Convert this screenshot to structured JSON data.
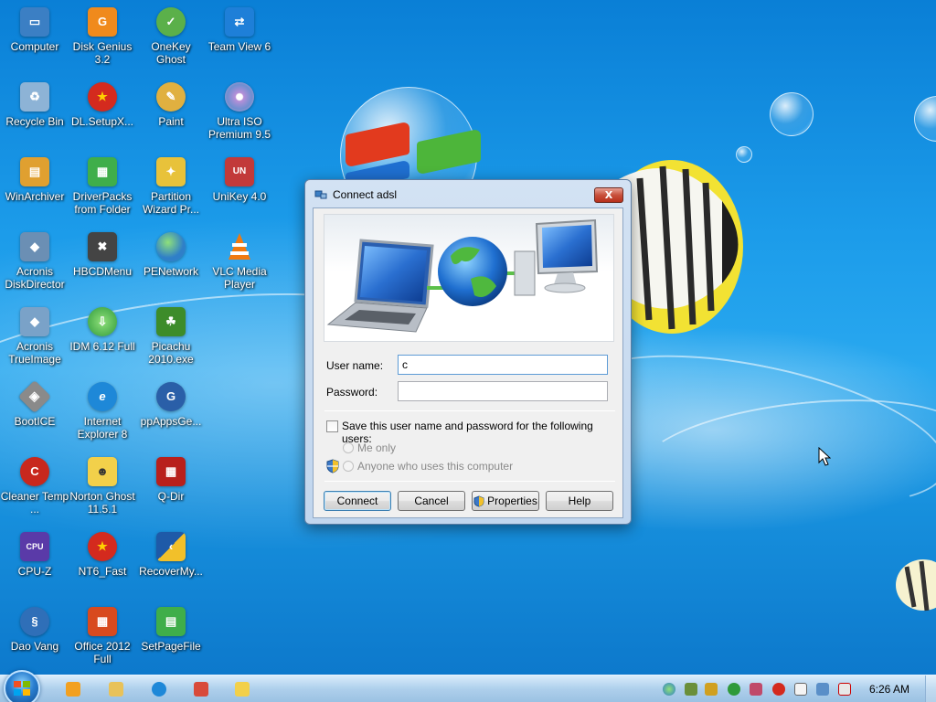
{
  "desktop": {
    "icons": [
      {
        "label": "Computer",
        "icon": "computer-icon",
        "color": "#3b7fc4"
      },
      {
        "label": "Disk Genius 3.2",
        "icon": "diskgenius-icon",
        "color": "#f08a1c"
      },
      {
        "label": "OneKey Ghost",
        "icon": "onekey-ghost-icon",
        "color": "#5bb04a"
      },
      {
        "label": "Team View 6",
        "icon": "teamviewer-icon",
        "color": "#1e7fd8"
      },
      {
        "label": "Recycle Bin",
        "icon": "recycle-bin-icon",
        "color": "#8db3d6"
      },
      {
        "label": "DL.SetupX...",
        "icon": "star-icon",
        "color": "#d42a1e"
      },
      {
        "label": "Paint",
        "icon": "paint-icon",
        "color": "#e0b040"
      },
      {
        "label": "Ultra ISO Premium 9.5",
        "icon": "disc-icon",
        "color": "#9a6fc2"
      },
      {
        "label": "WinArchiver",
        "icon": "archive-icon",
        "color": "#e0a030"
      },
      {
        "label": "DriverPacks from Folder",
        "icon": "driverpacks-icon",
        "color": "#3fae4a"
      },
      {
        "label": "Partition Wizard Pr...",
        "icon": "partition-wizard-icon",
        "color": "#e8c23a"
      },
      {
        "label": "UniKey 4.0",
        "icon": "unikey-icon",
        "color": "#c23a3a"
      },
      {
        "label": "Acronis DiskDirector",
        "icon": "acronis-icon",
        "color": "#6b8fb4"
      },
      {
        "label": "HBCDMenu",
        "icon": "tools-icon",
        "color": "#444444"
      },
      {
        "label": "PENetwork",
        "icon": "network-globe-icon",
        "color": "#2f7fc8"
      },
      {
        "label": "VLC Media Player",
        "icon": "vlc-icon",
        "color": "#f07a10"
      },
      {
        "label": "Acronis TrueImage",
        "icon": "acronis-icon",
        "color": "#7aa2c8"
      },
      {
        "label": "IDM 6.12 Full",
        "icon": "idm-icon",
        "color": "#2f9a3a"
      },
      {
        "label": "Picachu 2010.exe",
        "icon": "picachu-icon",
        "color": "#3d8c2a"
      },
      {
        "label": "BootICE",
        "icon": "bootice-icon",
        "color": "#8a8a8a"
      },
      {
        "label": "Internet Explorer 8",
        "icon": "ie-icon",
        "color": "#1e88d8"
      },
      {
        "label": "ppAppsGe...",
        "icon": "ppapps-icon",
        "color": "#2a5fa8"
      },
      {
        "label": "Cleaner Temp ...",
        "icon": "ccleaner-icon",
        "color": "#c8281e"
      },
      {
        "label": "Norton Ghost 11.5.1",
        "icon": "ghost-icon",
        "color": "#f2d04a"
      },
      {
        "label": "Q-Dir",
        "icon": "qdir-icon",
        "color": "#b8201c"
      },
      {
        "label": "CPU-Z",
        "icon": "cpuz-icon",
        "color": "#5a3aa8"
      },
      {
        "label": "NT6_Fast",
        "icon": "star-icon",
        "color": "#d42a1e"
      },
      {
        "label": "RecoverMy...",
        "icon": "recover-icon",
        "color": "#1e5aa8"
      },
      {
        "label": "Dao Vang",
        "icon": "daovang-icon",
        "color": "#2f6fb8"
      },
      {
        "label": "Office 2012 Full",
        "icon": "office-icon",
        "color": "#d84a1e"
      },
      {
        "label": "SetPageFile",
        "icon": "setpagefile-icon",
        "color": "#3fae4a"
      }
    ]
  },
  "dialog": {
    "title": "Connect adsl",
    "close_symbol": "X",
    "username_label": "User name:",
    "username_value": "c",
    "password_label": "Password:",
    "password_value": "",
    "save_label": "Save this user name and password for the following users:",
    "save_checked": false,
    "me_only_label": "Me only",
    "anyone_label": "Anyone who uses this computer",
    "buttons": {
      "connect": "Connect",
      "cancel": "Cancel",
      "properties": "Properties",
      "help": "Help"
    }
  },
  "taskbar": {
    "pinned": [
      "media-player-icon",
      "explorer-icon",
      "ie-icon",
      "paint-icon",
      "ghost-icon"
    ],
    "tray": [
      "network-globe-icon",
      "tray-tool-icon",
      "shield-icon",
      "play-icon",
      "tray-app-icon",
      "antivirus-icon",
      "flag-icon",
      "monitor-icon",
      "speaker-muted-icon"
    ],
    "clock": "6:26 AM"
  }
}
